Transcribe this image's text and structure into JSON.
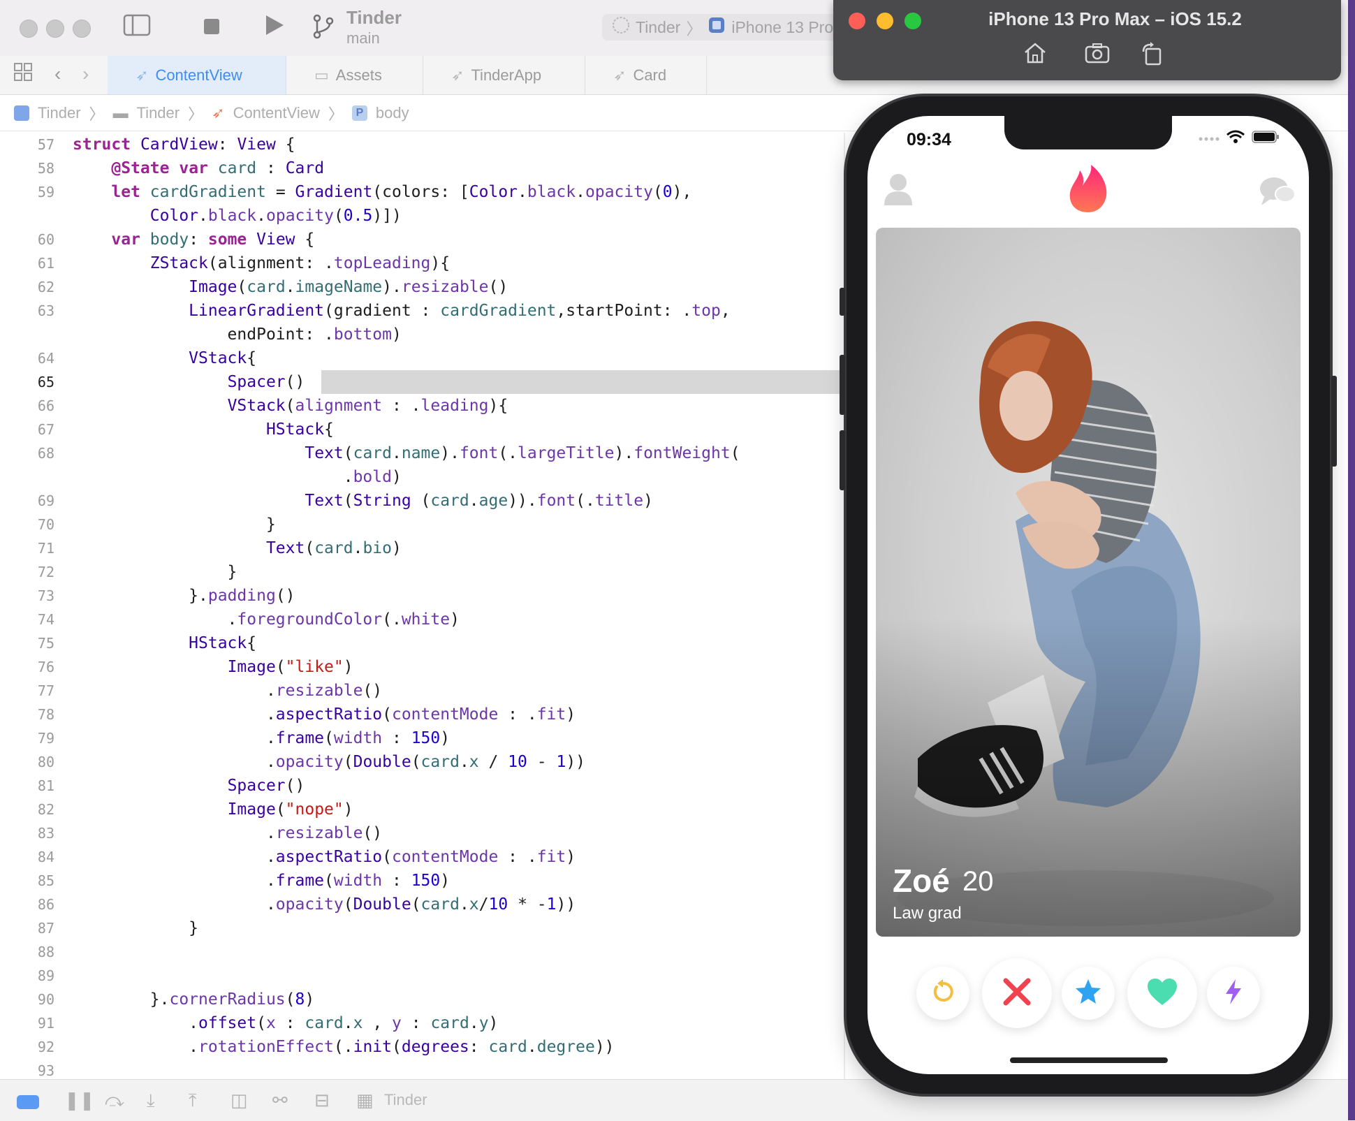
{
  "toolbar": {
    "project_name": "Tinder",
    "branch": "main",
    "scheme": "Tinder",
    "destination": "iPhone 13 Pro"
  },
  "tabs": [
    {
      "label": "ContentView",
      "active": true
    },
    {
      "label": "Assets",
      "active": false
    },
    {
      "label": "TinderApp",
      "active": false
    },
    {
      "label": "Card",
      "active": false
    }
  ],
  "breadcrumb": [
    "Tinder",
    "Tinder",
    "ContentView",
    "body"
  ],
  "editor": {
    "current_line": "65",
    "lines": [
      {
        "n": "57",
        "html": "<span class='kw'>struct</span> <span class='ty'>CardView</span>: <span class='ty'>View</span> {"
      },
      {
        "n": "58",
        "html": "    <span class='kw'>@State</span> <span class='kw'>var</span> <span class='pr'>card</span> : <span class='ty'>Card</span>"
      },
      {
        "n": "59",
        "html": "    <span class='kw'>let</span> <span class='pr'>cardGradient</span> = <span class='ty'>Gradient</span>(colors: [<span class='ty'>Color</span>.<span class='me'>black</span>.<span class='me'>opacity</span>(<span class='nu'>0</span>),"
      },
      {
        "n": "",
        "html": "        <span class='ty'>Color</span>.<span class='me'>black</span>.<span class='me'>opacity</span>(<span class='nu'>0.5</span>)])"
      },
      {
        "n": "60",
        "html": "    <span class='kw'>var</span> <span class='pr'>body</span>: <span class='kw'>some</span> <span class='ty'>View</span> {"
      },
      {
        "n": "61",
        "html": "        <span class='ty'>ZStack</span>(alignment: .<span class='me'>topLeading</span>){"
      },
      {
        "n": "62",
        "html": "            <span class='ty'>Image</span>(<span class='pr'>card</span>.<span class='pr'>imageName</span>).<span class='me'>resizable</span>()"
      },
      {
        "n": "63",
        "html": "            <span class='ty'>LinearGradient</span>(gradient : <span class='pr'>cardGradient</span>,startPoint: .<span class='me'>top</span>,"
      },
      {
        "n": "",
        "html": "                endPoint: .<span class='me'>bottom</span>)"
      },
      {
        "n": "64",
        "html": "            <span class='ty'>VStack</span>{"
      },
      {
        "n": "65",
        "html": "                <span class='ty'>Spacer</span>()",
        "highlight": true
      },
      {
        "n": "66",
        "html": "                <span class='ty'>VStack</span>(<span class='me'>alignment</span> : .<span class='me'>leading</span>){"
      },
      {
        "n": "67",
        "html": "                    <span class='ty'>HStack</span>{"
      },
      {
        "n": "68",
        "html": "                        <span class='ty'>Text</span>(<span class='pr'>card</span>.<span class='pr'>name</span>).<span class='me'>font</span>(.<span class='me'>largeTitle</span>).<span class='me'>fontWeight</span>("
      },
      {
        "n": "",
        "html": "                            .<span class='me'>bold</span>)"
      },
      {
        "n": "69",
        "html": "                        <span class='ty'>Text</span>(<span class='ty'>String</span> (<span class='pr'>card</span>.<span class='pr'>age</span>)).<span class='me'>font</span>(.<span class='me'>title</span>)"
      },
      {
        "n": "70",
        "html": "                    }"
      },
      {
        "n": "71",
        "html": "                    <span class='ty'>Text</span>(<span class='pr'>card</span>.<span class='pr'>bio</span>)"
      },
      {
        "n": "72",
        "html": "                }"
      },
      {
        "n": "73",
        "html": "            }.<span class='me'>padding</span>()"
      },
      {
        "n": "74",
        "html": "                .<span class='me'>foregroundColor</span>(.<span class='me'>white</span>)"
      },
      {
        "n": "75",
        "html": "            <span class='ty'>HStack</span>{"
      },
      {
        "n": "76",
        "html": "                <span class='ty'>Image</span>(<span class='st'>\"like\"</span>)"
      },
      {
        "n": "77",
        "html": "                    .<span class='me'>resizable</span>()"
      },
      {
        "n": "78",
        "html": "                    .<span class='ty'>aspectRatio</span>(<span class='me'>contentMode</span> : .<span class='me'>fit</span>)"
      },
      {
        "n": "79",
        "html": "                    .<span class='ty'>frame</span>(<span class='me'>width</span> : <span class='nu'>150</span>)"
      },
      {
        "n": "80",
        "html": "                    .<span class='me'>opacity</span>(<span class='ty'>Double</span>(<span class='pr'>card</span>.<span class='pr'>x</span> / <span class='nu'>10</span> - <span class='nu'>1</span>))"
      },
      {
        "n": "81",
        "html": "                <span class='ty'>Spacer</span>()"
      },
      {
        "n": "82",
        "html": "                <span class='ty'>Image</span>(<span class='st'>\"nope\"</span>)"
      },
      {
        "n": "83",
        "html": "                    .<span class='me'>resizable</span>()"
      },
      {
        "n": "84",
        "html": "                    .<span class='ty'>aspectRatio</span>(<span class='me'>contentMode</span> : .<span class='me'>fit</span>)"
      },
      {
        "n": "85",
        "html": "                    .<span class='ty'>frame</span>(<span class='me'>width</span> : <span class='nu'>150</span>)"
      },
      {
        "n": "86",
        "html": "                    .<span class='me'>opacity</span>(<span class='ty'>Double</span>(<span class='pr'>card</span>.<span class='pr'>x</span>/<span class='nu'>10</span> * -<span class='nu'>1</span>))"
      },
      {
        "n": "87",
        "html": "            }"
      },
      {
        "n": "88",
        "html": ""
      },
      {
        "n": "89",
        "html": ""
      },
      {
        "n": "90",
        "html": "        }.<span class='me'>cornerRadius</span>(<span class='nu'>8</span>)"
      },
      {
        "n": "91",
        "html": "            .<span class='ty'>offset</span>(<span class='me'>x</span> : <span class='pr'>card</span>.<span class='pr'>x</span> , <span class='me'>y</span> : <span class='pr'>card</span>.<span class='pr'>y</span>)"
      },
      {
        "n": "92",
        "html": "            .<span class='me'>rotationEffect</span>(.<span class='ty'>init</span>(<span class='ty'>degrees</span>: <span class='pr'>card</span>.<span class='pr'>degree</span>))"
      },
      {
        "n": "93",
        "html": ""
      }
    ]
  },
  "statusbar": {
    "scheme": "Tinder"
  },
  "simulator": {
    "title": "iPhone 13 Pro Max – iOS 15.2",
    "status_time": "09:34",
    "card": {
      "name": "Zoé",
      "age": "20",
      "bio": "Law grad"
    }
  },
  "colors": {
    "tinder_flame": "#fd5564",
    "nope_red": "#f0434f",
    "super_like_blue": "#2ea4f0",
    "like_green": "#4bdcb0",
    "rewind_gold": "#f6bd3e",
    "boost_purple": "#a15ef5",
    "accent_blue": "#3f8cf2"
  }
}
